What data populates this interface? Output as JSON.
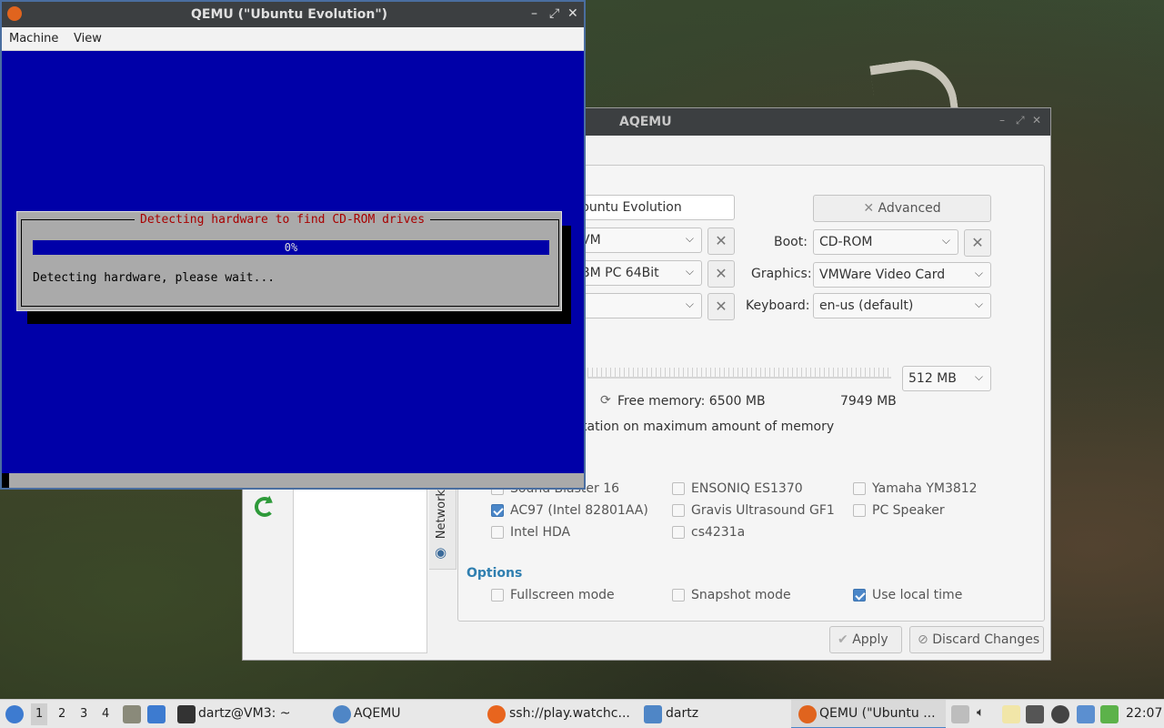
{
  "qemu": {
    "title": "QEMU (\"Ubuntu Evolution\")",
    "menu": [
      "Machine",
      "View"
    ],
    "dialog": {
      "title": "Detecting hardware to find CD-ROM drives",
      "progress": "0%",
      "progress_value": 0,
      "message": "Detecting hardware, please wait..."
    }
  },
  "aqemu": {
    "title": "AQEMU",
    "name_value": "buntu Evolution",
    "advanced_label": "Advanced",
    "combo1": "VM",
    "combo2": "BM PC 64Bit",
    "combo3": "",
    "boot_label": "Boot:",
    "boot_value": "CD-ROM",
    "graphics_label": "Graphics:",
    "graphics_value": "VMWare Video Card",
    "keyboard_label": "Keyboard:",
    "keyboard_value": "en-us (default)",
    "memory_value": "512 MB",
    "free_memory": "Free memory: 6500 MB",
    "total_memory": "7949 MB",
    "memory_limit_text": "tation on maximum amount of memory",
    "side_tab": "Network",
    "audio": [
      {
        "label": "Sound Blaster 16",
        "checked": false
      },
      {
        "label": "ENSONIQ ES1370",
        "checked": false
      },
      {
        "label": "Yamaha YM3812",
        "checked": false
      },
      {
        "label": "AC97 (Intel 82801AA)",
        "checked": true
      },
      {
        "label": "Gravis Ultrasound GF1",
        "checked": false
      },
      {
        "label": "PC Speaker",
        "checked": false
      },
      {
        "label": "Intel HDA",
        "checked": false
      },
      {
        "label": "cs4231a",
        "checked": false
      }
    ],
    "options_title": "Options",
    "options": [
      {
        "label": "Fullscreen mode",
        "checked": false
      },
      {
        "label": "Snapshot mode",
        "checked": false
      },
      {
        "label": "Use local time",
        "checked": true
      }
    ],
    "apply_label": "Apply",
    "discard_label": "Discard Changes"
  },
  "taskbar": {
    "workspaces": [
      "1",
      "2",
      "3",
      "4"
    ],
    "items": [
      {
        "label": "dartz@VM3: ~"
      },
      {
        "label": "AQEMU"
      },
      {
        "label": "ssh://play.watchc..."
      },
      {
        "label": "dartz"
      },
      {
        "label": "QEMU (\"Ubuntu ..."
      }
    ],
    "clock": "22:07"
  },
  "colors": {
    "qemu_bg": "#0000a8",
    "accent": "#4a86c8",
    "section": "#2f7fb0"
  }
}
